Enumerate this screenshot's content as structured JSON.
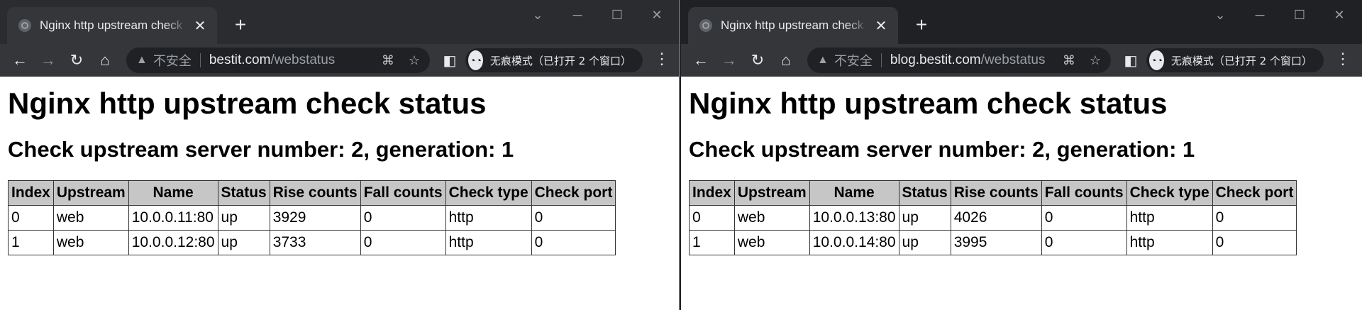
{
  "windows": [
    {
      "tab_title": "Nginx http upstream check status",
      "security": "不安全",
      "url_host": "bestit.com",
      "url_path": "/webstatus",
      "incognito_label": "无痕模式（已打开 2 个窗口）",
      "page": {
        "title": "Nginx http upstream check status",
        "subtitle": "Check upstream server number: 2, generation: 1",
        "headers": [
          "Index",
          "Upstream",
          "Name",
          "Status",
          "Rise counts",
          "Fall counts",
          "Check type",
          "Check port"
        ],
        "rows": [
          [
            "0",
            "web",
            "10.0.0.11:80",
            "up",
            "3929",
            "0",
            "http",
            "0"
          ],
          [
            "1",
            "web",
            "10.0.0.12:80",
            "up",
            "3733",
            "0",
            "http",
            "0"
          ]
        ]
      }
    },
    {
      "tab_title": "Nginx http upstream check status",
      "security": "不安全",
      "url_host": "blog.bestit.com",
      "url_path": "/webstatus",
      "incognito_label": "无痕模式（已打开 2 个窗口）",
      "page": {
        "title": "Nginx http upstream check status",
        "subtitle": "Check upstream server number: 2, generation: 1",
        "headers": [
          "Index",
          "Upstream",
          "Name",
          "Status",
          "Rise counts",
          "Fall counts",
          "Check type",
          "Check port"
        ],
        "rows": [
          [
            "0",
            "web",
            "10.0.0.13:80",
            "up",
            "4026",
            "0",
            "http",
            "0"
          ],
          [
            "1",
            "web",
            "10.0.0.14:80",
            "up",
            "3995",
            "0",
            "http",
            "0"
          ]
        ]
      }
    }
  ],
  "icons": {
    "favicon": "globe-icon",
    "close": "close-icon",
    "new_tab": "plus-icon",
    "back": "back-arrow-icon",
    "forward": "forward-arrow-icon",
    "reload": "reload-icon",
    "home": "home-icon",
    "warning": "warning-icon",
    "translate": "translate-icon",
    "bookmark": "star-icon",
    "side_panel": "side-panel-icon",
    "incognito": "incognito-icon",
    "menu": "kebab-menu-icon"
  },
  "colors": {
    "tabbar": "#202124",
    "toolbar": "#35363a",
    "table_header": "#c6c6c6"
  }
}
